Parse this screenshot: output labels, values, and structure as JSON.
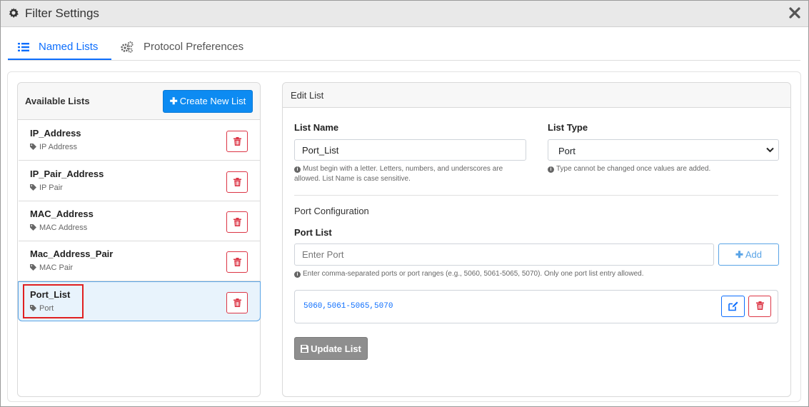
{
  "window": {
    "title": "Filter Settings",
    "icons": {
      "title": "gear-icon",
      "close": "close-icon"
    }
  },
  "tabs": [
    {
      "label": "Named Lists",
      "icon": "list-icon",
      "active": true
    },
    {
      "label": "Protocol Preferences",
      "icon": "gears-icon",
      "active": false
    }
  ],
  "left_panel": {
    "title": "Available Lists",
    "create_button": "Create New List",
    "items": [
      {
        "name": "IP_Address",
        "type": "IP Address",
        "selected": false
      },
      {
        "name": "IP_Pair_Address",
        "type": "IP Pair",
        "selected": false
      },
      {
        "name": "MAC_Address",
        "type": "MAC Address",
        "selected": false
      },
      {
        "name": "Mac_Address_Pair",
        "type": "MAC Pair",
        "selected": false
      },
      {
        "name": "Port_List",
        "type": "Port",
        "selected": true
      }
    ]
  },
  "edit_list": {
    "title": "Edit List",
    "list_name": {
      "label": "List Name",
      "value": "Port_List",
      "hint_line1": "Must begin with a letter. Letters, numbers, and underscores are",
      "hint_line2": "allowed. List Name is case sensitive."
    },
    "list_type": {
      "label": "List Type",
      "value": "Port",
      "hint": "Type cannot be changed once values are added."
    },
    "port_config": {
      "section_title": "Port Configuration",
      "label": "Port List",
      "placeholder": "Enter Port",
      "add_button": "Add",
      "hint": "Enter comma-separated ports or port ranges (e.g., 5060, 5061-5065, 5070). Only one port list entry allowed.",
      "entry": "5060,5061-5065,5070"
    },
    "update_button": "Update List"
  },
  "colors": {
    "primary": "#0d8bf2",
    "danger": "#dc3545",
    "selected_bg": "#e8f3fc",
    "highlight": "#e02020"
  }
}
